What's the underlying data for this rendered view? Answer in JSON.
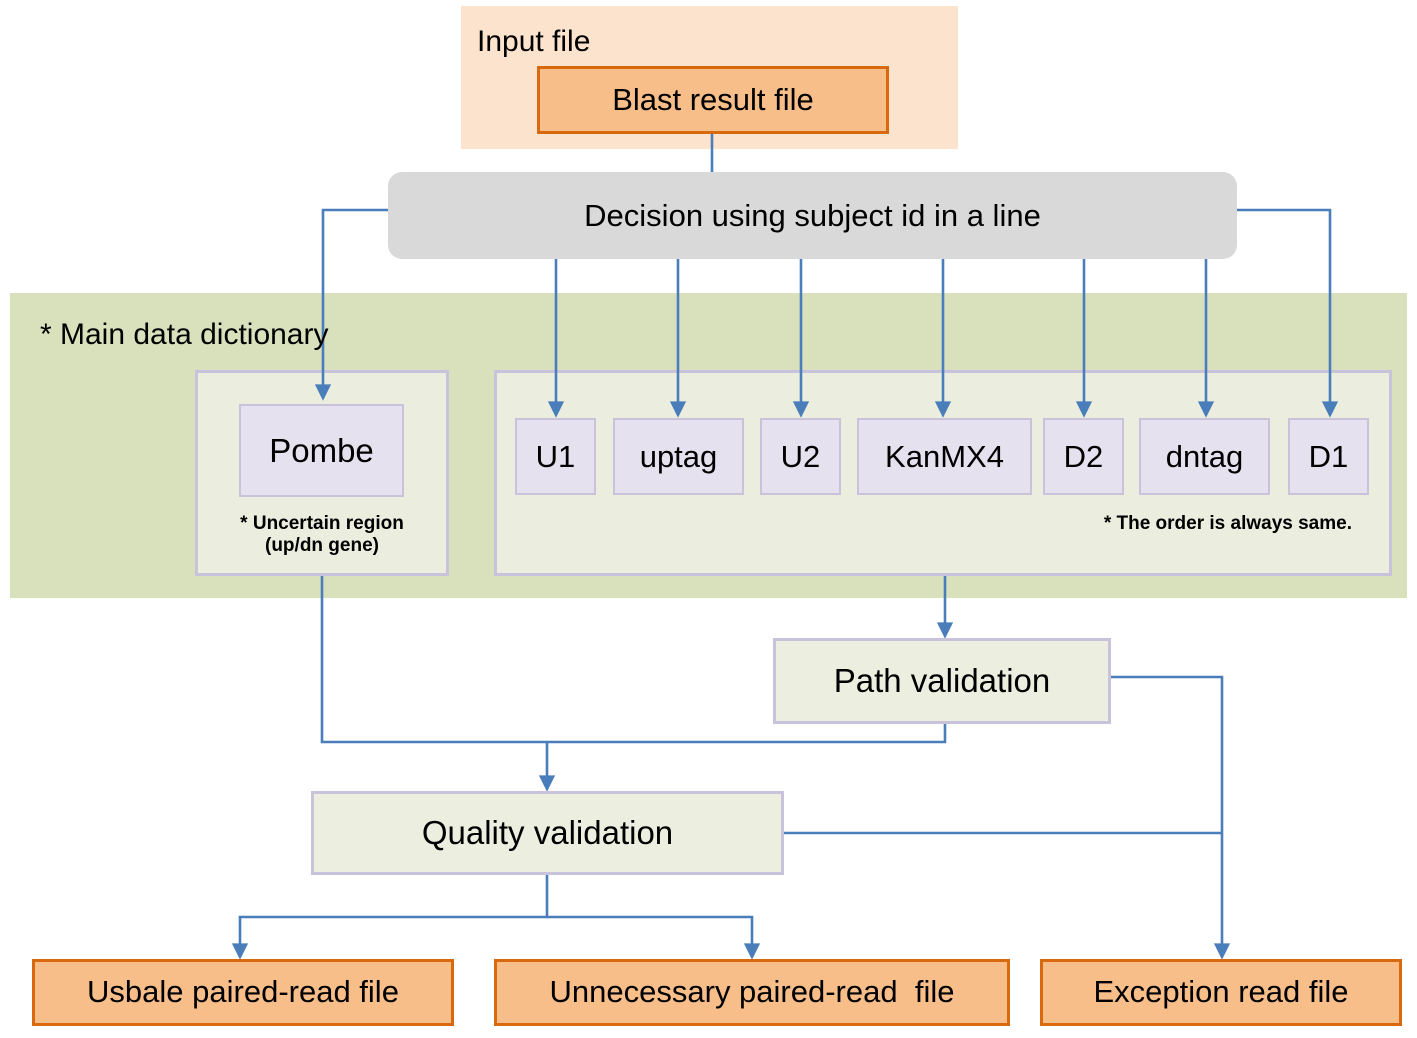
{
  "diagram": {
    "title_region": {
      "input_file_label": "Input file"
    },
    "input_node": {
      "label": "Blast result file"
    },
    "decision": {
      "label": "Decision using subject id in a line"
    },
    "dictionary": {
      "title": "* Main data dictionary",
      "uncertain_group": {
        "node_label": "Pombe",
        "note": "* Uncertain region\n(up/dn gene)"
      },
      "ordered_group": {
        "note": "* The order is always same.",
        "items": [
          {
            "label": "U1"
          },
          {
            "label": "uptag"
          },
          {
            "label": "U2"
          },
          {
            "label": "KanMX4"
          },
          {
            "label": "D2"
          },
          {
            "label": "dntag"
          },
          {
            "label": "D1"
          }
        ]
      }
    },
    "validation": {
      "path": "Path validation",
      "quality": "Quality validation"
    },
    "outputs": [
      {
        "label": "Usbale paired-read file"
      },
      {
        "label": "Unnecessary paired-read  file"
      },
      {
        "label": "Exception read file"
      }
    ],
    "colors": {
      "orange_fill": "#F7BE8A",
      "orange_border": "#D9690E",
      "input_panel": "#FCE3CE",
      "decision_fill": "#D9D9D9",
      "dict_band": "#D8E0BC",
      "subgroup_fill": "#EBEEDF",
      "purple_border": "#C8C3DA",
      "lavender_fill": "#E6E1EF",
      "validation_fill": "#ECEEE0",
      "connector": "#4A7EBB"
    }
  }
}
